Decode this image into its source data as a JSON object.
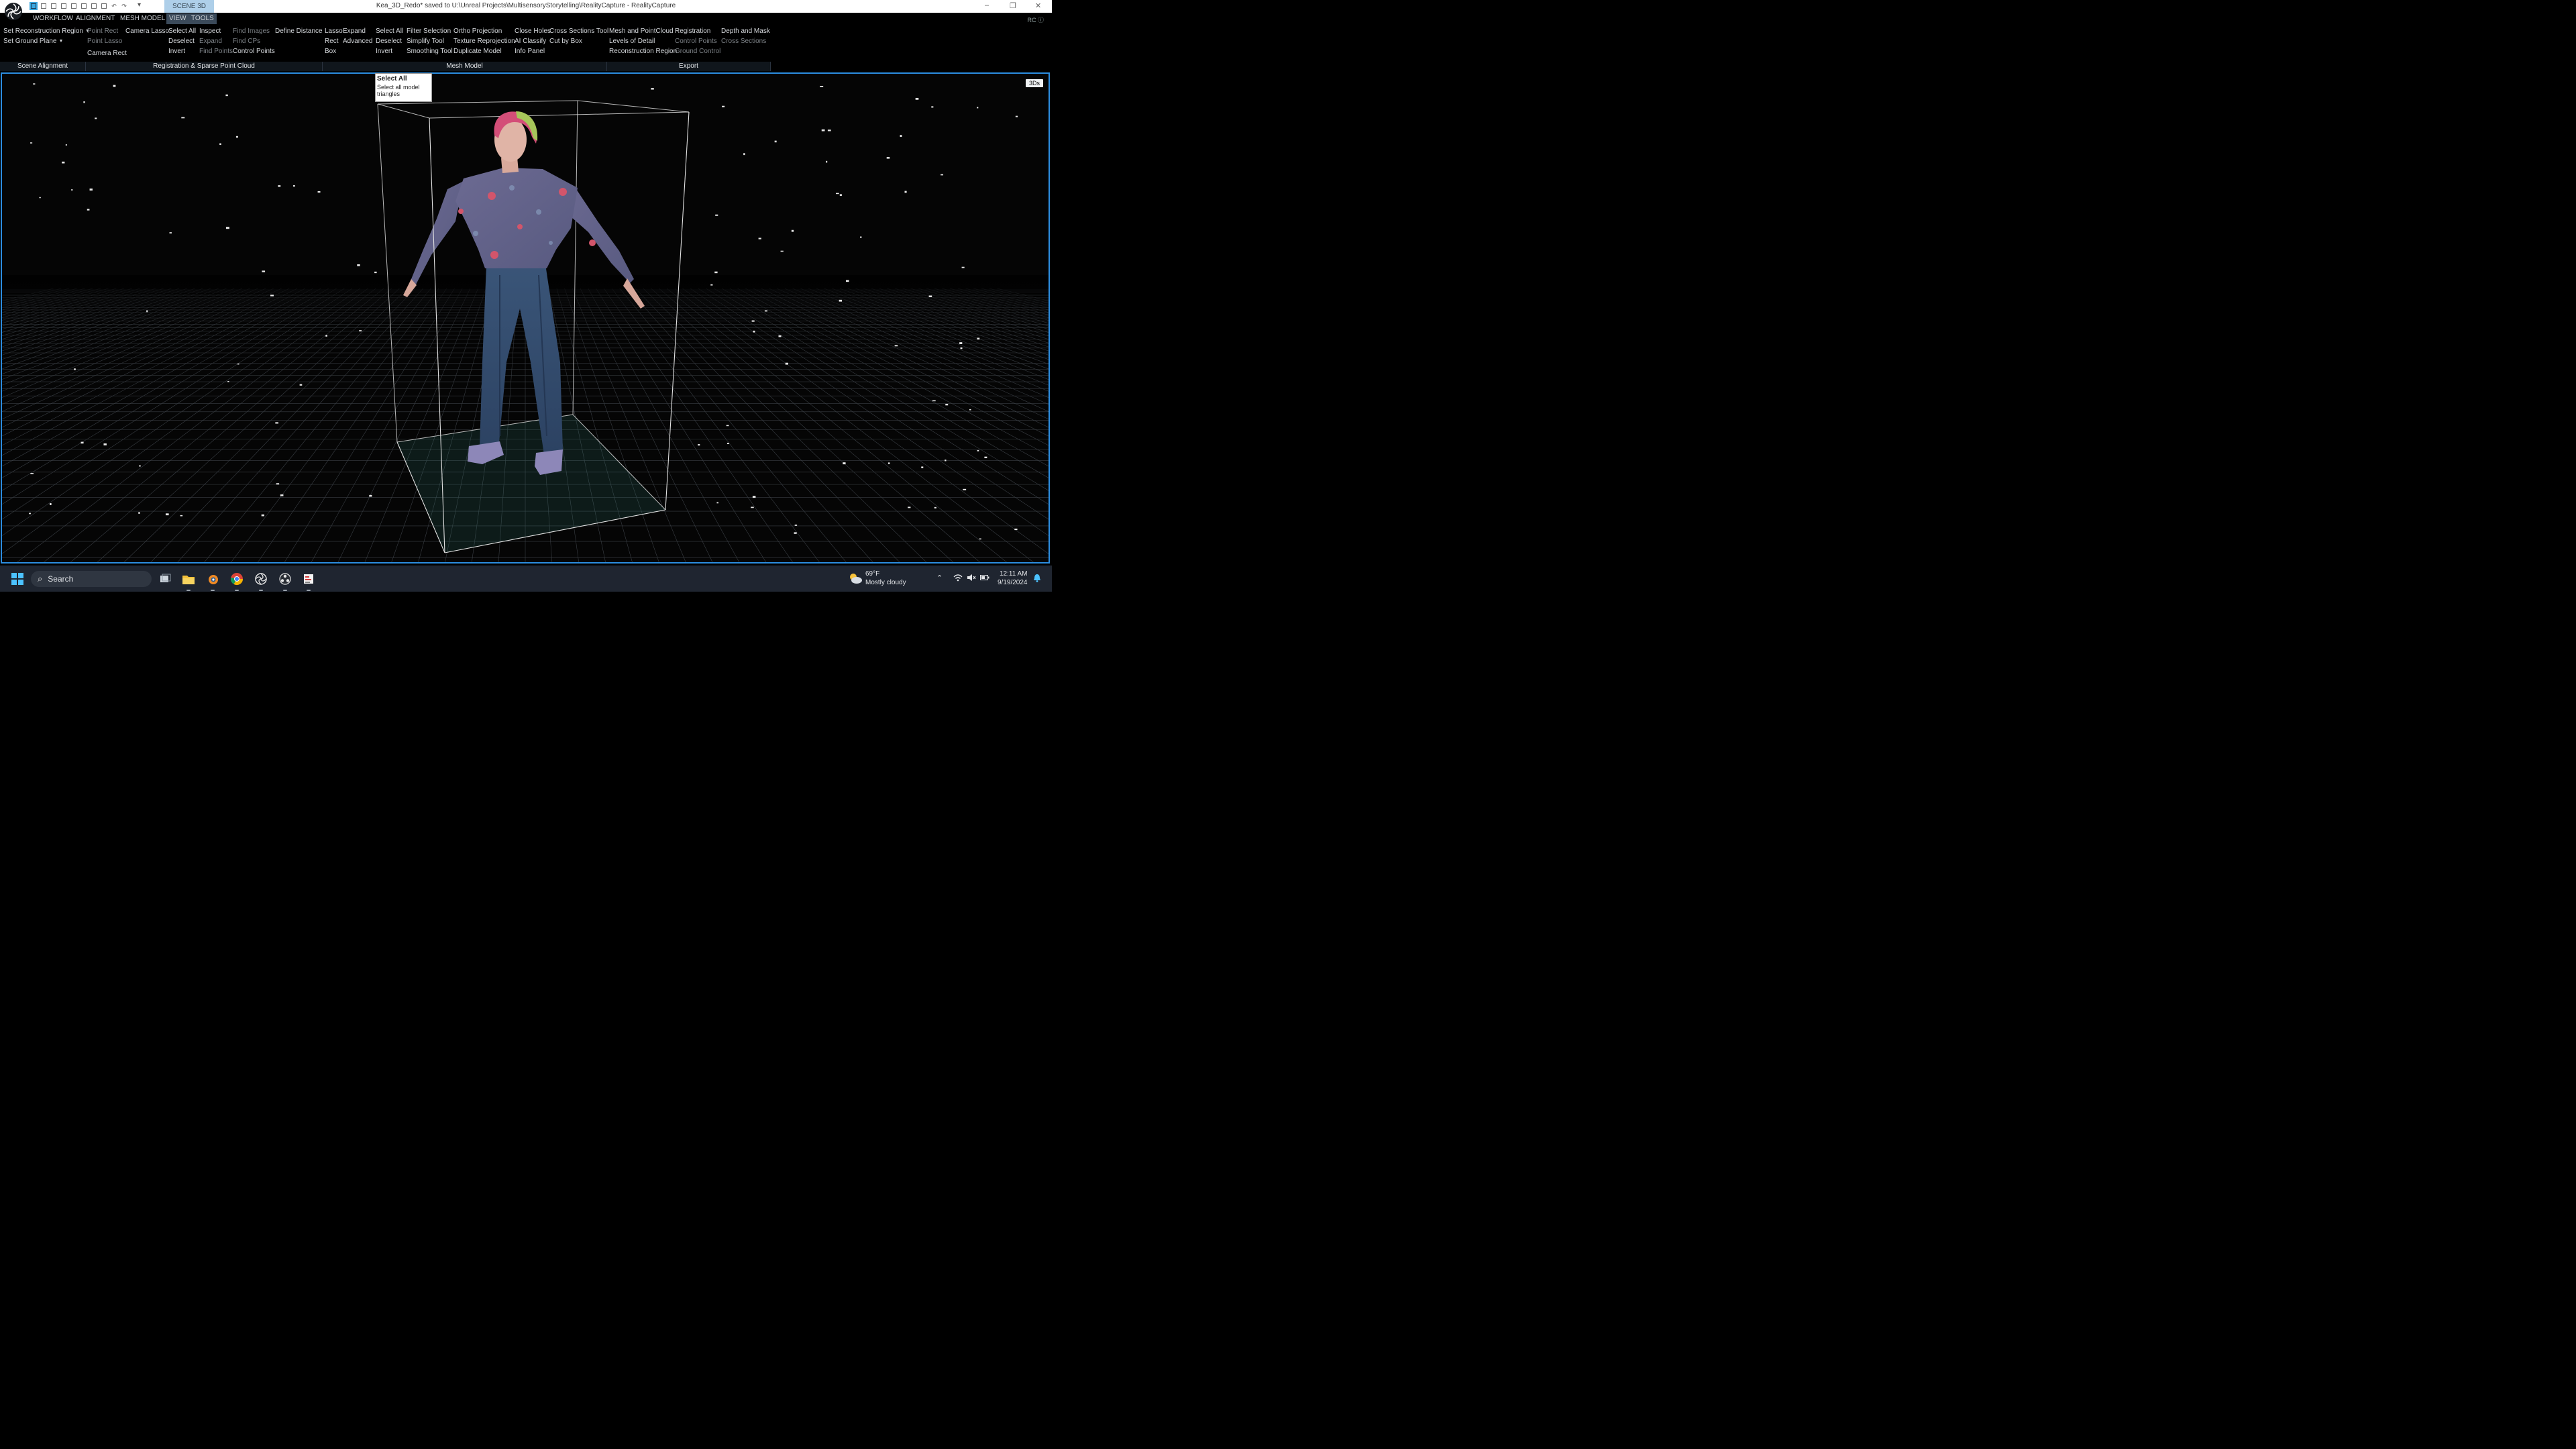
{
  "window": {
    "title": "Kea_3D_Redo* saved to U:\\Unreal Projects\\MultisensoryStorytelling\\RealityCapture - RealityCapture",
    "scene_tab": "SCENE 3D",
    "minimize": "–",
    "restore": "❐",
    "close": "✕",
    "rc_label": "RC"
  },
  "menu": {
    "workflow": "WORKFLOW",
    "alignment": "ALIGNMENT",
    "mesh_model": "MESH MODEL",
    "view": "VIEW",
    "tools": "TOOLS"
  },
  "ribbon": {
    "scene_alignment": {
      "label": "Scene Alignment",
      "set_reconstruction_region": "Set Reconstruction Region",
      "set_ground_plane": "Set Ground Plane"
    },
    "registration": {
      "label": "Registration & Sparse Point Cloud",
      "point_rect": "Point Rect",
      "point_lasso": "Point Lasso",
      "camera_rect": "Camera Rect",
      "camera_lasso": "Camera Lasso",
      "select_all": "Select All",
      "deselect": "Deselect",
      "invert": "Invert",
      "inspect": "Inspect",
      "expand": "Expand",
      "find_points": "Find Points",
      "find_images": "Find Images",
      "find_cps": "Find CPs",
      "control_points": "Control Points",
      "define_distance": "Define Distance"
    },
    "mesh_model": {
      "label": "Mesh Model",
      "lasso": "Lasso",
      "rect": "Rect",
      "box": "Box",
      "expand": "Expand",
      "advanced": "Advanced",
      "select_all": "Select All",
      "deselect": "Deselect",
      "invert": "Invert",
      "filter_selection": "Filter Selection",
      "simplify_tool": "Simplify Tool",
      "smoothing_tool": "Smoothing Tool",
      "ortho_projection": "Ortho Projection",
      "texture_reprojection": "Texture Reprojection",
      "duplicate_model": "Duplicate Model",
      "close_holes": "Close Holes",
      "ai_classify": "AI Classify",
      "info_panel": "Info Panel",
      "cross_sections_tool": "Cross Sections Tool",
      "cut_by_box": "Cut by Box"
    },
    "export": {
      "label": "Export",
      "mesh_and_pointcloud": "Mesh and PointCloud",
      "levels_of_detail": "Levels of Detail",
      "reconstruction_region": "Reconstruction Region",
      "registration": "Registration",
      "control_points": "Control Points",
      "ground_control": "Ground Control",
      "depth_and_mask": "Depth and Mask",
      "cross_sections": "Cross Sections"
    }
  },
  "tooltip": {
    "title": "Select All",
    "body": "Select all model triangles"
  },
  "viewport": {
    "badge": "3Ds",
    "grid_color": "#3a3f45",
    "box_color": "#d9d9d9",
    "accent": "#2c8de0"
  },
  "taskbar": {
    "search_label": "Search",
    "temperature": "69°F",
    "condition": "Mostly cloudy",
    "time": "12:11 AM",
    "date": "9/19/2024"
  }
}
